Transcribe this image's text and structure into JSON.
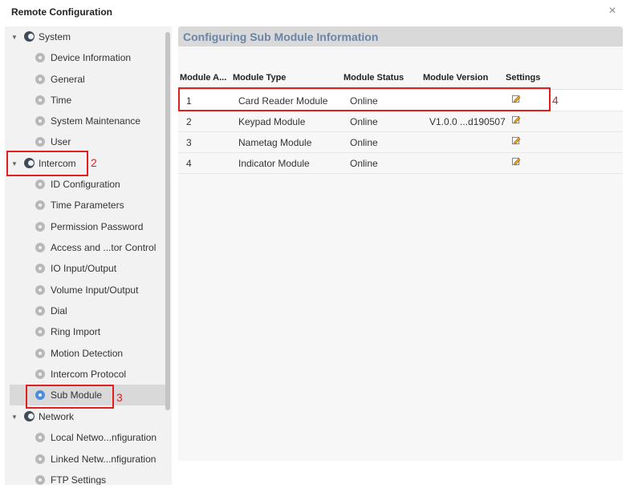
{
  "window": {
    "title": "Remote Configuration",
    "close_symbol": "×"
  },
  "sidebar": {
    "groups": [
      {
        "label": "System",
        "items": [
          "Device Information",
          "General",
          "Time",
          "System Maintenance",
          "User"
        ]
      },
      {
        "label": "Intercom",
        "items": [
          "ID Configuration",
          "Time Parameters",
          "Permission Password",
          "Access and ...tor Control",
          "IO Input/Output",
          "Volume Input/Output",
          "Dial",
          "Ring Import",
          "Motion Detection",
          "Intercom Protocol",
          "Sub Module"
        ]
      },
      {
        "label": "Network",
        "items": [
          "Local Netwo...nfiguration",
          "Linked Netw...nfiguration",
          "FTP Settings"
        ]
      }
    ],
    "selected": "Sub Module"
  },
  "main": {
    "title": "Configuring Sub Module Information",
    "columns": [
      "Module A...",
      "Module Type",
      "Module Status",
      "Module Version",
      "Settings"
    ],
    "rows": [
      {
        "address": "1",
        "type": "Card Reader Module",
        "status": "Online",
        "version": ""
      },
      {
        "address": "2",
        "type": "Keypad Module",
        "status": "Online",
        "version": "V1.0.0 ...d190507"
      },
      {
        "address": "3",
        "type": "Nametag Module",
        "status": "Online",
        "version": ""
      },
      {
        "address": "4",
        "type": "Indicator Module",
        "status": "Online",
        "version": ""
      }
    ]
  },
  "annotations": {
    "n2": "2",
    "n3": "3",
    "n4": "4"
  },
  "colors": {
    "accent_title": "#6a85a6",
    "annotation": "#e02020",
    "selected_icon": "#4a8fd8"
  }
}
